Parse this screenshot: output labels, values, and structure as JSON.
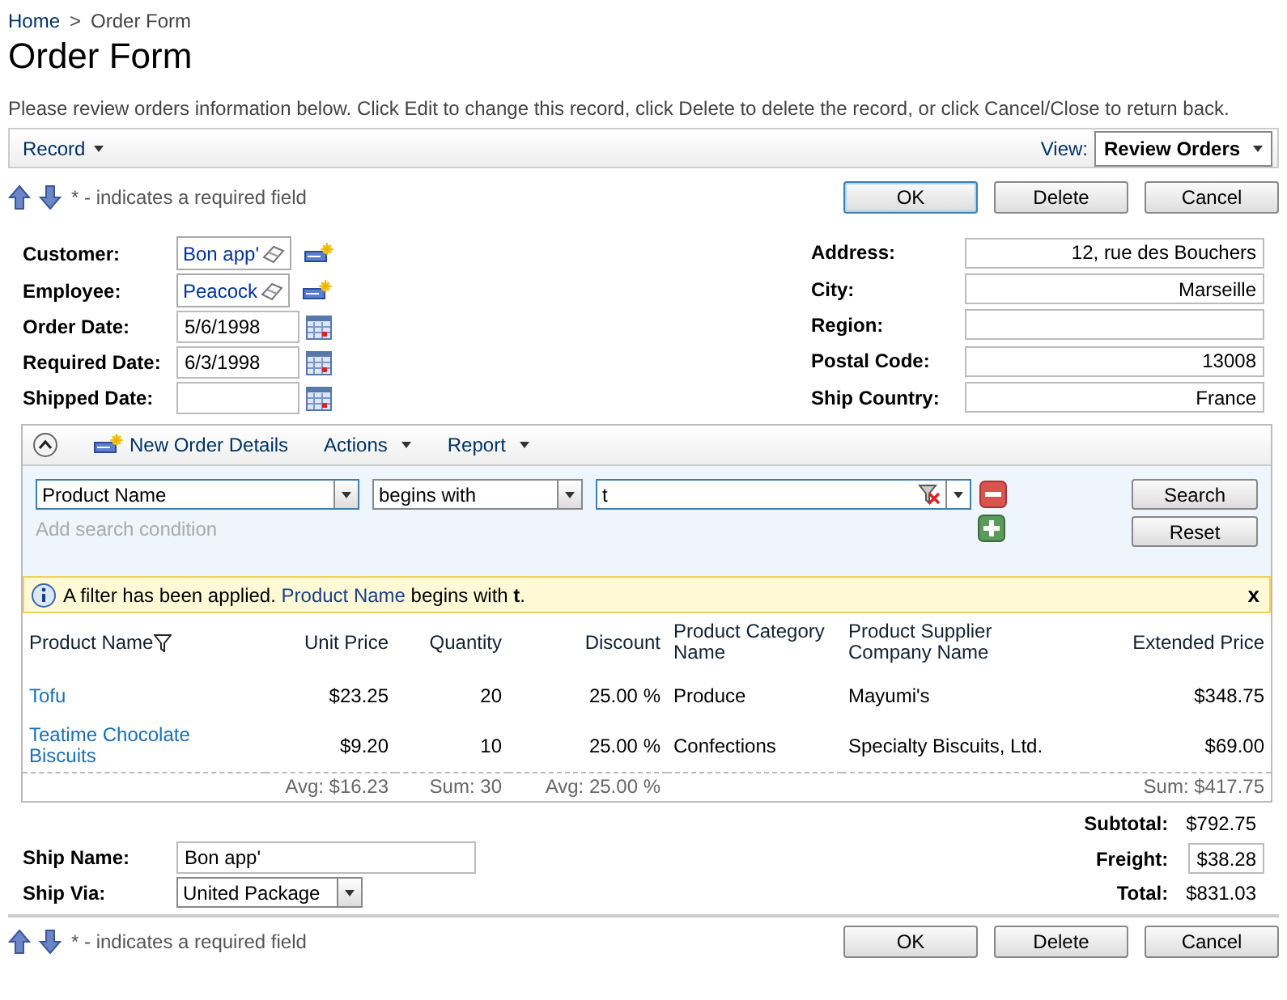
{
  "breadcrumb": {
    "items": [
      "Home",
      "Order Form"
    ],
    "separator": ">"
  },
  "title": "Order Form",
  "instructions": "Please review orders information below. Click Edit to change this record, click Delete to delete the record, or click Cancel/Close to return back.",
  "toolbar": {
    "menu": "Record",
    "view_label": "View:",
    "view_value": "Review Orders"
  },
  "top_actions": {
    "required_note": "* - indicates a required field",
    "buttons": [
      {
        "label": "OK",
        "focused": true
      },
      {
        "label": "Delete",
        "focused": false
      },
      {
        "label": "Cancel",
        "focused": false
      }
    ]
  },
  "left_fields": [
    {
      "label": "Customer:",
      "kind": "lookup",
      "value": "Bon app'"
    },
    {
      "label": "Employee:",
      "kind": "lookup",
      "value": "Peacock"
    },
    {
      "label": "Order Date:",
      "kind": "date",
      "value": "5/6/1998"
    },
    {
      "label": "Required Date:",
      "kind": "date",
      "value": "6/3/1998"
    },
    {
      "label": "Shipped Date:",
      "kind": "date"
    }
  ],
  "right_fields": [
    {
      "label": "Address:",
      "value": "12, rue des Bouchers"
    },
    {
      "label": "City:",
      "value": "Marseille"
    },
    {
      "label": "Region:"
    },
    {
      "label": "Postal Code:",
      "value": "13008"
    },
    {
      "label": "Ship Country:",
      "value": "France"
    }
  ],
  "details": {
    "expanded": true,
    "menu": [
      {
        "label": "New Order Details",
        "kind": "new"
      },
      {
        "label": "Actions",
        "kind": "menu"
      },
      {
        "label": "Report",
        "kind": "menu"
      }
    ],
    "filter": {
      "field": "Product Name",
      "operator": "begins with",
      "value": "t",
      "add_hint": "Add search condition",
      "buttons": [
        "Search",
        "Reset"
      ]
    },
    "message": {
      "before": "A filter has been applied.",
      "field": "Product Name",
      "after": "begins with **t**.",
      "close": "x"
    },
    "columns": [
      {
        "label": "Product Name",
        "filtered": true
      },
      {
        "label": "Unit Price",
        "filtered": false
      },
      {
        "label": "Quantity",
        "filtered": false
      },
      {
        "label": "Discount",
        "filtered": false
      },
      {
        "label": "Product Category Name",
        "filtered": false
      },
      {
        "label": "Product Supplier Company Name",
        "filtered": false
      },
      {
        "label": "Extended Price",
        "filtered": false
      }
    ],
    "rows": [
      [
        "Tofu",
        "$23.25",
        "20",
        "25.00 %",
        "Produce",
        "Mayumi's",
        "$348.75"
      ],
      [
        "Teatime Chocolate Biscuits",
        "$9.20",
        "10",
        "25.00 %",
        "Confections",
        "Specialty Biscuits, Ltd.",
        "$69.00"
      ]
    ],
    "totals": {
      "unit_price": "Avg: $16.23",
      "quantity": "Sum: 30",
      "discount": "Avg: 25.00 %",
      "extended_price": "Sum: $417.75"
    }
  },
  "ship_fields": [
    {
      "label": "Ship Name:",
      "kind": "text",
      "value": "Bon app'"
    },
    {
      "label": "Ship Via:",
      "kind": "select",
      "value": "United Package"
    }
  ],
  "summary": [
    {
      "label": "Subtotal:",
      "value": "$792.75",
      "boxed": false
    },
    {
      "label": "Freight:",
      "value": "$38.28",
      "boxed": true
    },
    {
      "label": "Total:",
      "value": "$831.03",
      "boxed": false
    }
  ],
  "bottom_actions": {
    "required_note": "* - indicates a required field",
    "buttons": [
      {
        "label": "OK",
        "focused": false
      },
      {
        "label": "Delete",
        "focused": false
      },
      {
        "label": "Cancel",
        "focused": false
      }
    ]
  }
}
